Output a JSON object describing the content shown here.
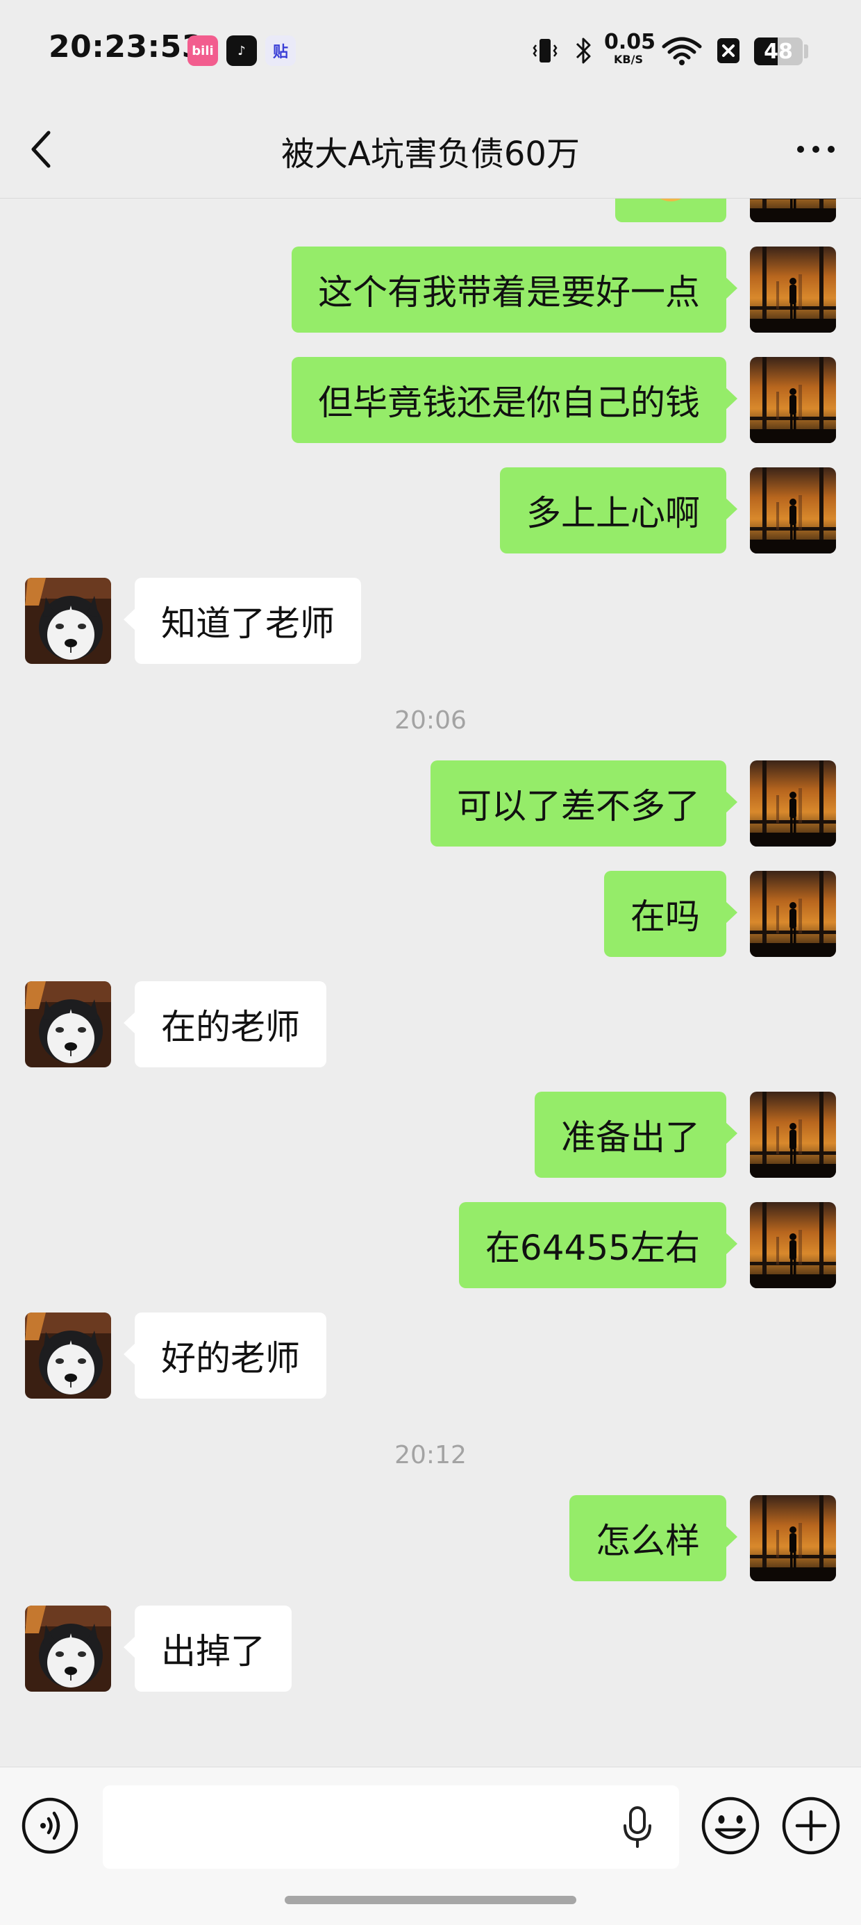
{
  "status_bar": {
    "time": "20:23:53",
    "apps": [
      {
        "name": "bilibili",
        "label": "bili"
      },
      {
        "name": "douyin",
        "label": "♪"
      },
      {
        "name": "tieba",
        "label": "贴"
      }
    ],
    "network_speed": "0.05",
    "network_speed_unit": "KB/S",
    "battery_level": "48",
    "battery_fraction": 0.48,
    "icons": [
      "vibrate-icon",
      "bluetooth-icon",
      "wifi-icon",
      "no-sim-icon"
    ]
  },
  "header": {
    "title": "被大A坑害负债60万",
    "back_icon": "chevron-left-icon",
    "more_icon": "more-dots-icon"
  },
  "messages": [
    {
      "type": "sticker",
      "from": "self",
      "sticker": "doge-emoji"
    },
    {
      "type": "text",
      "from": "self",
      "text": "这个有我带着是要好一点"
    },
    {
      "type": "text",
      "from": "self",
      "text": "但毕竟钱还是你自己的钱"
    },
    {
      "type": "text",
      "from": "self",
      "text": "多上上心啊"
    },
    {
      "type": "text",
      "from": "other",
      "text": "知道了老师"
    },
    {
      "type": "time",
      "text": "20:06"
    },
    {
      "type": "text",
      "from": "self",
      "text": "可以了差不多了"
    },
    {
      "type": "text",
      "from": "self",
      "text": "在吗"
    },
    {
      "type": "text",
      "from": "other",
      "text": "在的老师"
    },
    {
      "type": "text",
      "from": "self",
      "text": "准备出了"
    },
    {
      "type": "text",
      "from": "self",
      "text": "在64455左右"
    },
    {
      "type": "text",
      "from": "other",
      "text": "好的老师"
    },
    {
      "type": "time",
      "text": "20:12"
    },
    {
      "type": "text",
      "from": "self",
      "text": "怎么样"
    },
    {
      "type": "text",
      "from": "other",
      "text": "出掉了"
    }
  ],
  "input_bar": {
    "placeholder": "",
    "value": "",
    "icons": [
      "voice-icon",
      "microphone-icon",
      "emoji-icon",
      "plus-icon"
    ]
  },
  "colors": {
    "background": "#ededed",
    "self_bubble": "#95ec69",
    "other_bubble": "#ffffff",
    "timestamp": "#a3a3a3"
  }
}
